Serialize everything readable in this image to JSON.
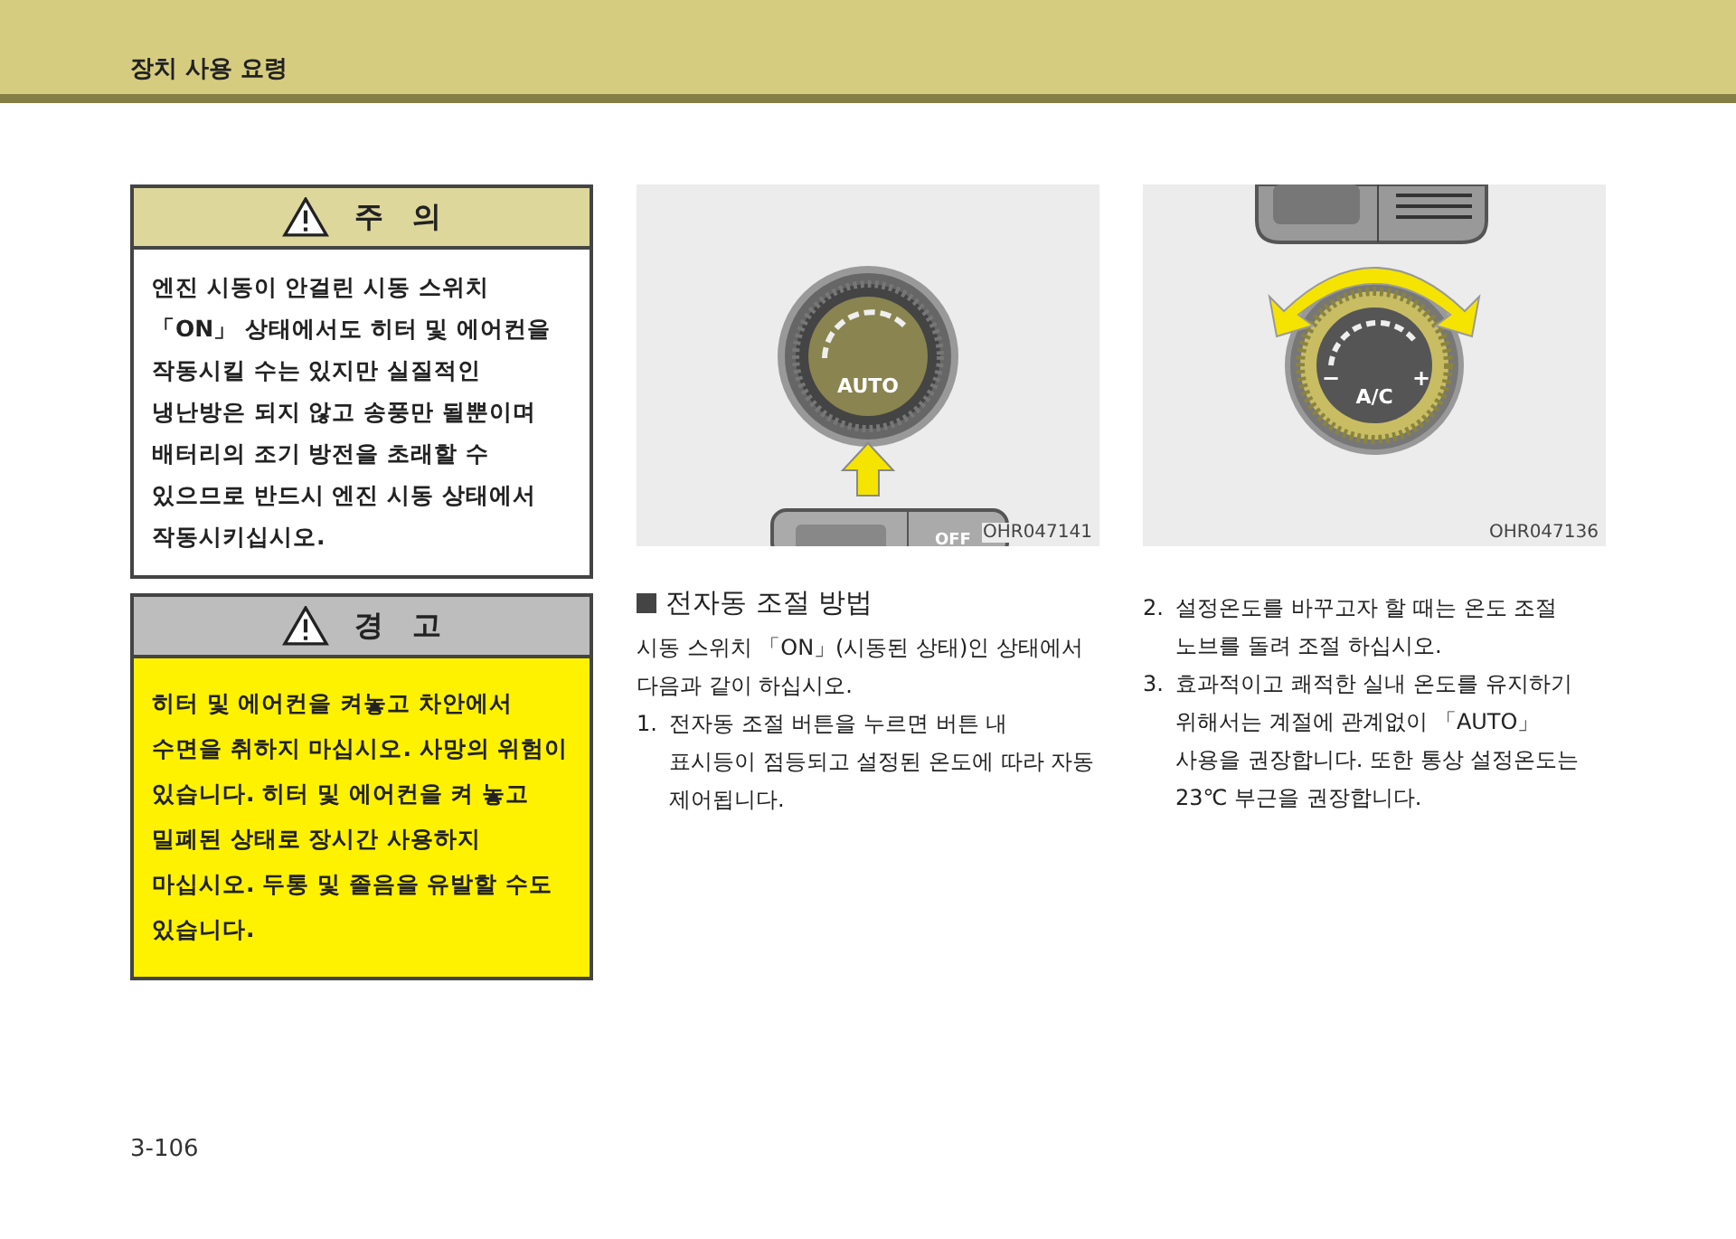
{
  "header": {
    "title": "장치 사용 요령"
  },
  "caution": {
    "title": "주　의",
    "text": "엔진 시동이 안걸린 시동 스위치 「ON」 상태에서도 히터 및 에어컨을 작동시킬 수는 있지만 실질적인 냉난방은 되지 않고 송풍만 될뿐이며 배터리의 조기 방전을 초래할 수 있으므로 반드시 엔진 시동 상태에서 작동시키십시오."
  },
  "warning": {
    "title": "경　고",
    "text": "히터 및 에어컨을 켜놓고 차안에서 수면을 취하지 마십시오. 사망의 위험이 있습니다. 히터 및 에어컨을 켜 놓고 밀폐된 상태로 장시간 사용하지 마십시오. 두통 및 졸음을 유발할 수도 있습니다."
  },
  "figures": [
    {
      "kind": "auto",
      "knob_label": "AUTO",
      "button_label": "OFF",
      "code": "OHR047141"
    },
    {
      "kind": "temp",
      "knob_label": "A/C",
      "minus": "−",
      "plus": "+",
      "code": "OHR047136"
    }
  ],
  "section": {
    "heading": "전자동 조절 방법",
    "intro": "시동 스위치 「ON」(시동된 상태)인 상태에서 다음과 같이 하십시오."
  },
  "steps": [
    {
      "number": "1.",
      "text": "전자동 조절 버튼을 누르면 버튼 내 표시등이 점등되고 설정된 온도에 따라 자동 제어됩니다."
    },
    {
      "number": "2.",
      "text": "설정온도를 바꾸고자 할 때는 온도 조절 노브를 돌려 조절 하십시오."
    },
    {
      "number": "3.",
      "text": "효과적이고 쾌적한 실내 온도를 유지하기 위해서는 계절에 관계없이 「AUTO」 사용을 권장합니다. 또한 통상 설정온도는 23℃ 부근을 권장합니다."
    }
  ],
  "page_number": "3-106"
}
